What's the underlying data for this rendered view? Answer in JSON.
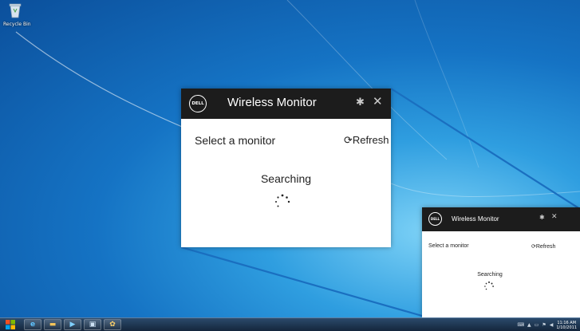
{
  "desktop": {
    "recycle_bin_label": "Recycle Bin"
  },
  "app": {
    "brand": "DELL",
    "title": "Wireless Monitor",
    "select_label": "Select a monitor",
    "refresh_label": "Refresh",
    "status": "Searching",
    "icons": {
      "settings": "gear-icon",
      "close": "close-icon",
      "refresh": "refresh-icon"
    },
    "colors": {
      "titlebar": "#1c1c1c",
      "body": "#ffffff",
      "accent": "#1a6fc0"
    }
  },
  "taskbar": {
    "clock_time": "11:16 AM",
    "clock_date": "1/10/2011"
  }
}
